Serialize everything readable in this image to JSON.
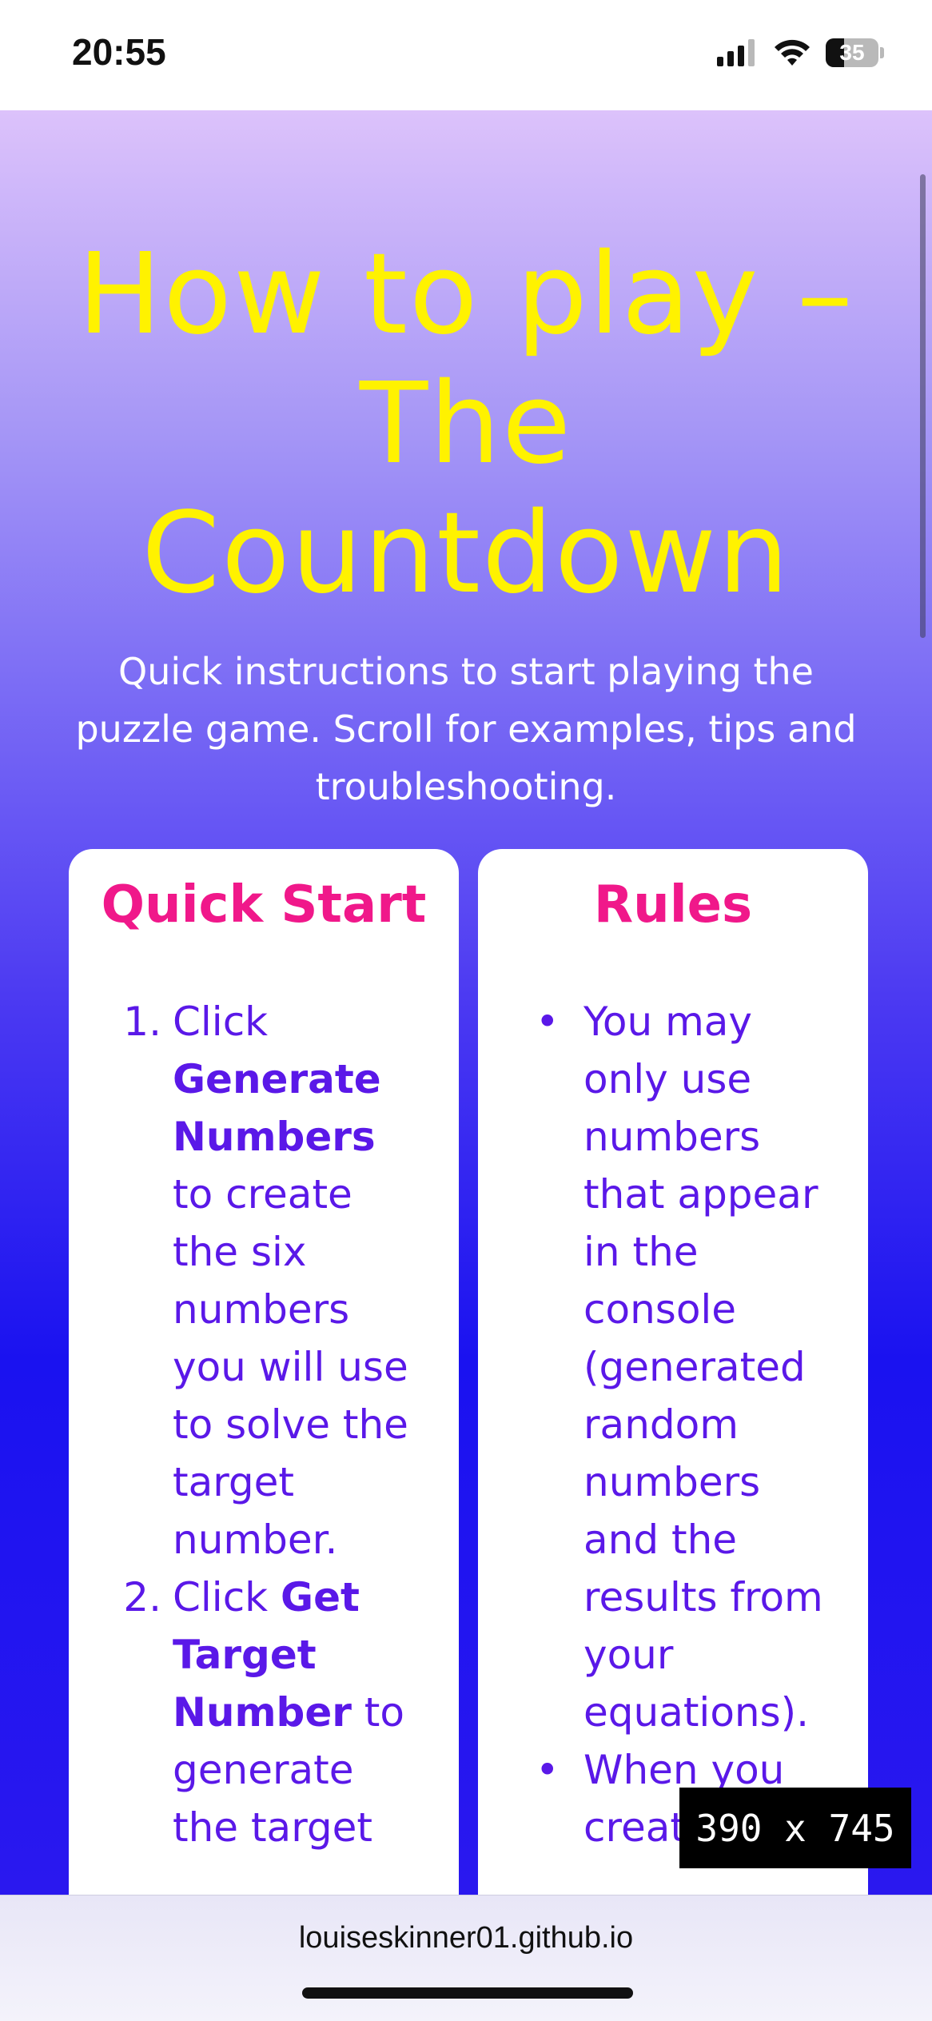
{
  "status_bar": {
    "time": "20:55",
    "battery": "35",
    "battery_level": 0.35,
    "icons": [
      "cellular-signal-icon",
      "wifi-icon",
      "battery-icon"
    ]
  },
  "page": {
    "title": "How to play – The Countdown",
    "subtitle": "Quick instructions to start playing the puzzle game. Scroll for examples, tips and troubleshooting."
  },
  "quick_start": {
    "heading": "Quick Start",
    "steps": [
      {
        "num": "1.",
        "pre": "Click ",
        "bold": "Generate Numbers",
        "post": " to create the six numbers you will use to solve the target number."
      },
      {
        "num": "2.",
        "pre": "Click ",
        "bold": "Get Target Number",
        "post": " to generate the target"
      }
    ]
  },
  "rules": {
    "heading": "Rules",
    "items": [
      "You may only use numbers that appear in the console (generated random numbers and the results from your equations).",
      "When you create a"
    ]
  },
  "overlay": {
    "size_label": "390 x 745"
  },
  "browser": {
    "url": "louiseskinner01.github.io"
  },
  "colors": {
    "title": "#fff200",
    "card_heading": "#f0188a",
    "card_text": "#5a18e8"
  }
}
